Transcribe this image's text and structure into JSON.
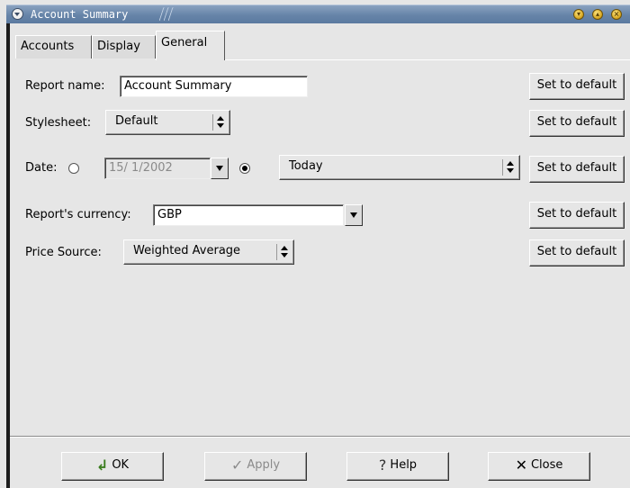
{
  "window": {
    "title": "Account Summary",
    "controls": [
      "minimize",
      "maximize",
      "close"
    ]
  },
  "tabs": [
    {
      "label": "Accounts",
      "active": false
    },
    {
      "label": "Display",
      "active": false
    },
    {
      "label": "General",
      "active": true
    }
  ],
  "form": {
    "report_name": {
      "label": "Report name:",
      "value": "Account Summary"
    },
    "stylesheet": {
      "label": "Stylesheet:",
      "value": "Default"
    },
    "date": {
      "label": "Date:",
      "absolute_value": "15/ 1/2002",
      "relative_value": "Today",
      "selected": "relative"
    },
    "currency": {
      "label": "Report's currency:",
      "value": "GBP"
    },
    "price_source": {
      "label": "Price Source:",
      "value": "Weighted Average"
    },
    "set_default_label": "Set to default"
  },
  "buttons": {
    "ok": {
      "label": "OK",
      "icon": "ok-arrow-icon"
    },
    "apply": {
      "label": "Apply",
      "icon": "check-icon",
      "disabled": true
    },
    "help": {
      "label": "Help",
      "icon": "question-icon"
    },
    "close": {
      "label": "Close",
      "icon": "x-icon"
    }
  }
}
